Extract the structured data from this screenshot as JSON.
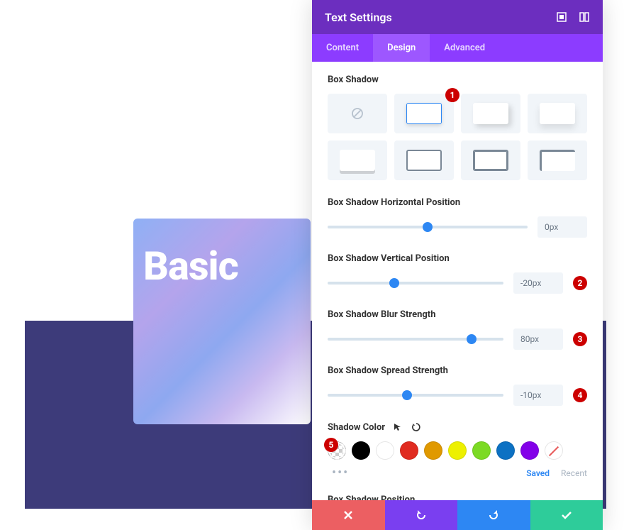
{
  "card": {
    "title": "Basic"
  },
  "panel": {
    "title": "Text Settings",
    "tabs": [
      "Content",
      "Design",
      "Advanced"
    ],
    "activeTab": 1
  },
  "boxShadow": {
    "label": "Box Shadow",
    "selectedPreset": 1
  },
  "sliders": [
    {
      "label": "Box Shadow Horizontal Position",
      "value": "0px",
      "pct": 50
    },
    {
      "label": "Box Shadow Vertical Position",
      "value": "-20px",
      "pct": 38
    },
    {
      "label": "Box Shadow Blur Strength",
      "value": "80px",
      "pct": 82
    },
    {
      "label": "Box Shadow Spread Strength",
      "value": "-10px",
      "pct": 45
    }
  ],
  "shadowColor": {
    "label": "Shadow Color",
    "swatches": [
      {
        "type": "checker"
      },
      {
        "color": "#000000"
      },
      {
        "type": "white"
      },
      {
        "color": "#e02b20"
      },
      {
        "color": "#e09900"
      },
      {
        "color": "#edf000"
      },
      {
        "color": "#7cda24"
      },
      {
        "color": "#0c71c3"
      },
      {
        "color": "#8300e9"
      },
      {
        "type": "strike"
      }
    ],
    "saved": "Saved",
    "recent": "Recent"
  },
  "lastSection": "Box Shadow Position",
  "badges": [
    "1",
    "2",
    "3",
    "4",
    "5"
  ]
}
